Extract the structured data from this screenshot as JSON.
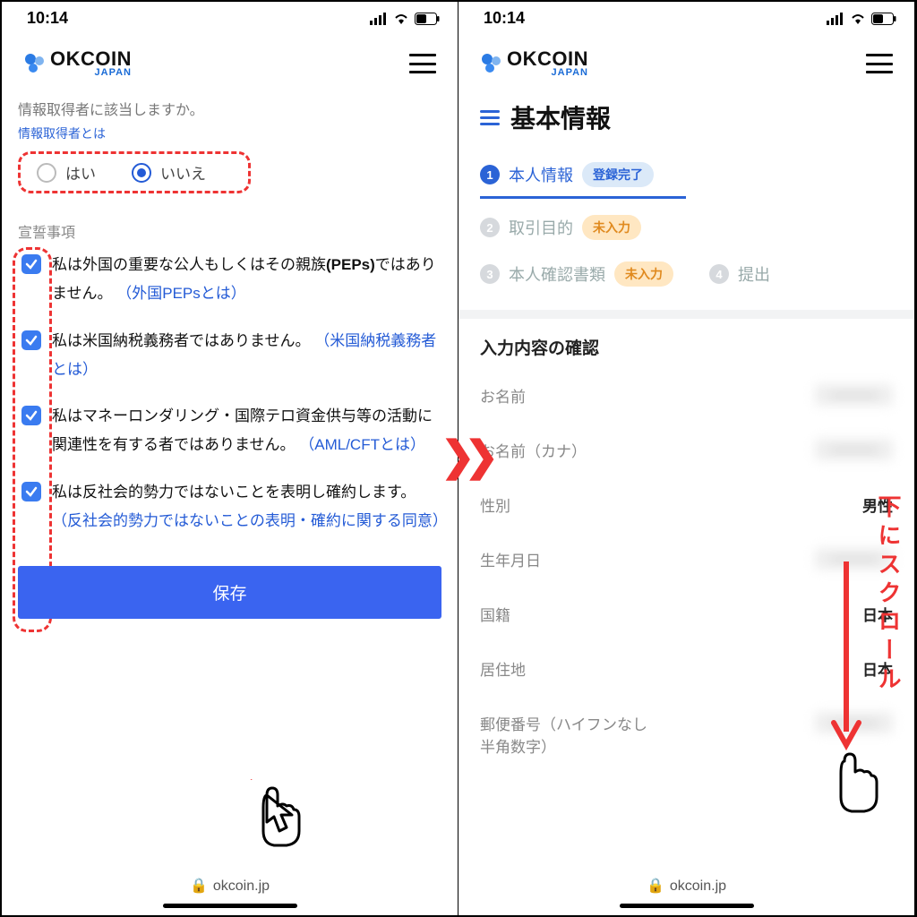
{
  "status": {
    "time": "10:14"
  },
  "brand": {
    "name": "OKCOIN",
    "sub": "JAPAN"
  },
  "url": "okcoin.jp",
  "left": {
    "question": "情報取得者に該当しますか。",
    "question_help": "情報取得者とは",
    "radio_yes": "はい",
    "radio_no": "いいえ",
    "oath_heading": "宣誓事項",
    "oath1_text": "私は外国の重要な公人もしくはその親族(PEPs)ではありません。",
    "oath1_link": "（外国PEPsとは）",
    "oath2_text": "私は米国納税義務者ではありません。",
    "oath2_link": "（米国納税義務者とは）",
    "oath3_text": "私はマネーロンダリング・国際テロ資金供与等の活動に関連性を有する者ではありません。",
    "oath3_link": "（AML/CFTとは）",
    "oath4_text": "私は反社会的勢力ではないことを表明し確約します。",
    "oath4_link": "（反社会的勢力ではないことの表明・確約に関する同意）",
    "save": "保存"
  },
  "right": {
    "title": "基本情報",
    "steps": {
      "s1": "本人情報",
      "s1_badge": "登録完了",
      "s2": "取引目的",
      "s2_badge": "未入力",
      "s3": "本人確認書類",
      "s3_badge": "未入力",
      "s4": "提出"
    },
    "confirm_title": "入力内容の確認",
    "rows": {
      "name_label": "お名前",
      "name_value": "———",
      "kana_label": "お名前（カナ）",
      "kana_value": "———",
      "sex_label": "性別",
      "sex_value": "男性",
      "dob_label": "生年月日",
      "dob_value": "———",
      "nat_label": "国籍",
      "nat_value": "日本",
      "res_label": "居住地",
      "res_value": "日本",
      "zip_label": "郵便番号（ハイフンなし半角数字）",
      "zip_value": "———"
    }
  },
  "annotation": {
    "scroll_hint": "下にスクロール"
  }
}
